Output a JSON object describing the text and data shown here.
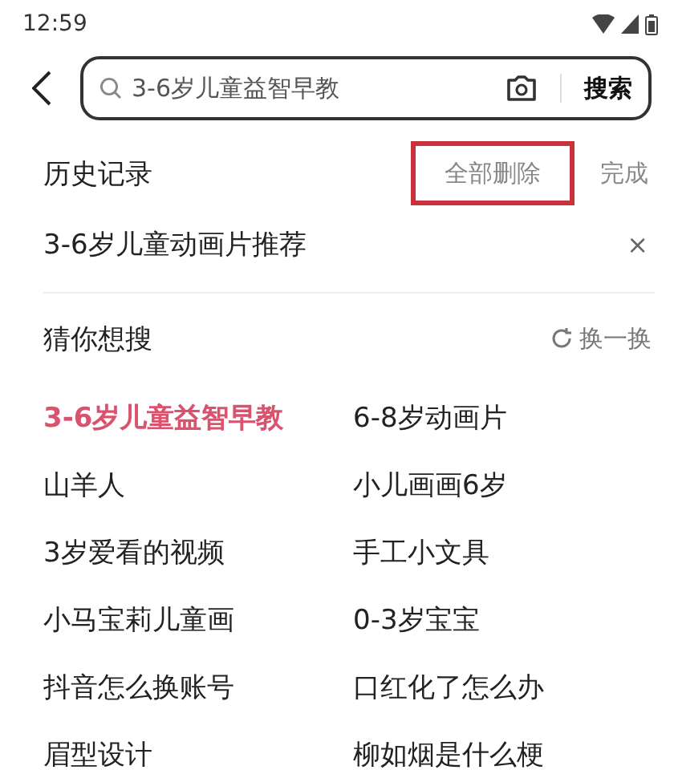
{
  "status_bar": {
    "time": "12:59"
  },
  "search": {
    "value": "3-6岁儿童益智早教",
    "button": "搜索"
  },
  "history": {
    "title": "历史记录",
    "delete_all": {
      "label": "全部删除",
      "highlighted": true
    },
    "done": "完成",
    "items": [
      {
        "text": "3-6岁儿童动画片推荐",
        "remove": "×"
      }
    ]
  },
  "suggestions": {
    "title": "猜你想搜",
    "refresh": "换一换",
    "items": [
      {
        "text": "3-6岁儿童益智早教",
        "hot": true
      },
      {
        "text": "6-8岁动画片",
        "hot": false
      },
      {
        "text": "山羊人",
        "hot": false
      },
      {
        "text": "小儿画画6岁",
        "hot": false
      },
      {
        "text": "3岁爱看的视频",
        "hot": false
      },
      {
        "text": "手工小文具",
        "hot": false
      },
      {
        "text": "小马宝莉儿童画",
        "hot": false
      },
      {
        "text": "0-3岁宝宝",
        "hot": false
      },
      {
        "text": "抖音怎么换账号",
        "hot": false
      },
      {
        "text": "口红化了怎么办",
        "hot": false
      },
      {
        "text": "眉型设计",
        "hot": false
      },
      {
        "text": "柳如烟是什么梗",
        "hot": false
      }
    ]
  }
}
